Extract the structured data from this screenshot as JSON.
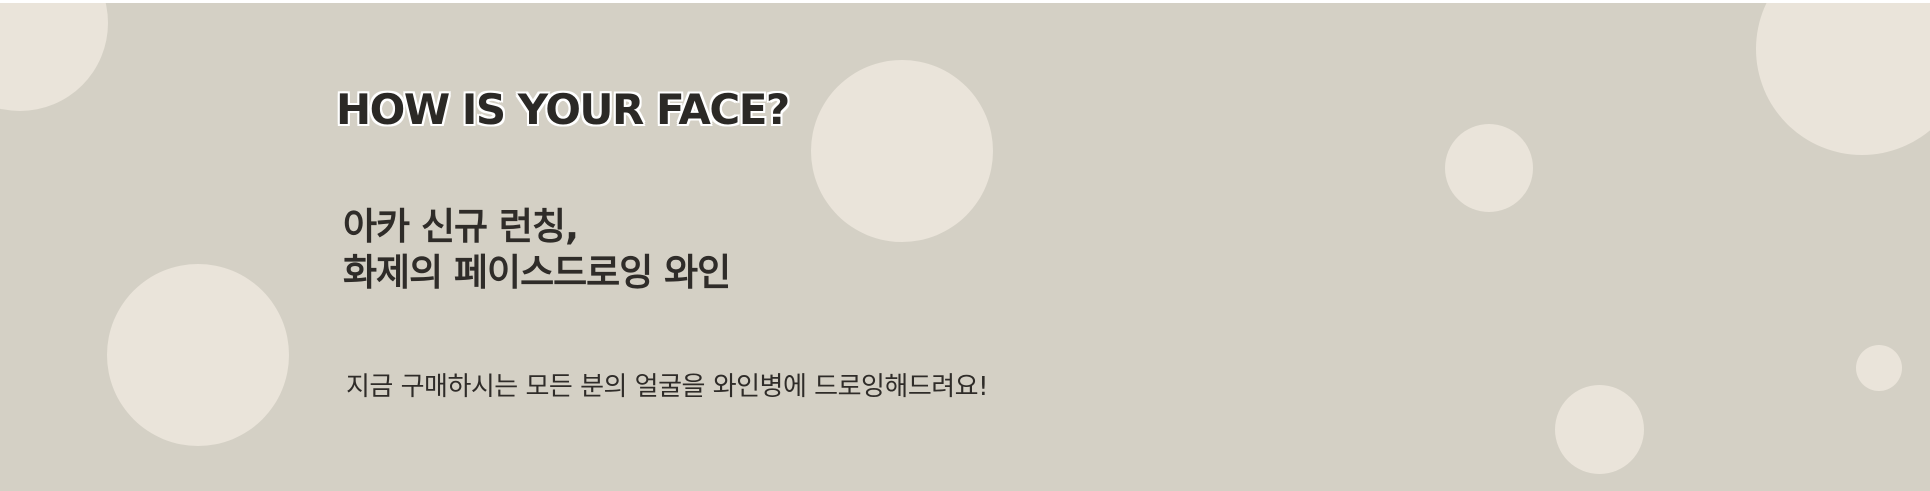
{
  "banner": {
    "headline": "HOW IS YOUR FACE?",
    "subhead_lines": [
      "아카 신규 런칭,",
      "화제의 페이스드로잉 와인"
    ],
    "description": "지금 구매하시는 모든 분의 얼굴을 와인병에 드로잉해드려요!"
  },
  "colors": {
    "background": "#d4d0c5",
    "circle": "#eae4da",
    "text": "#2b2926"
  }
}
